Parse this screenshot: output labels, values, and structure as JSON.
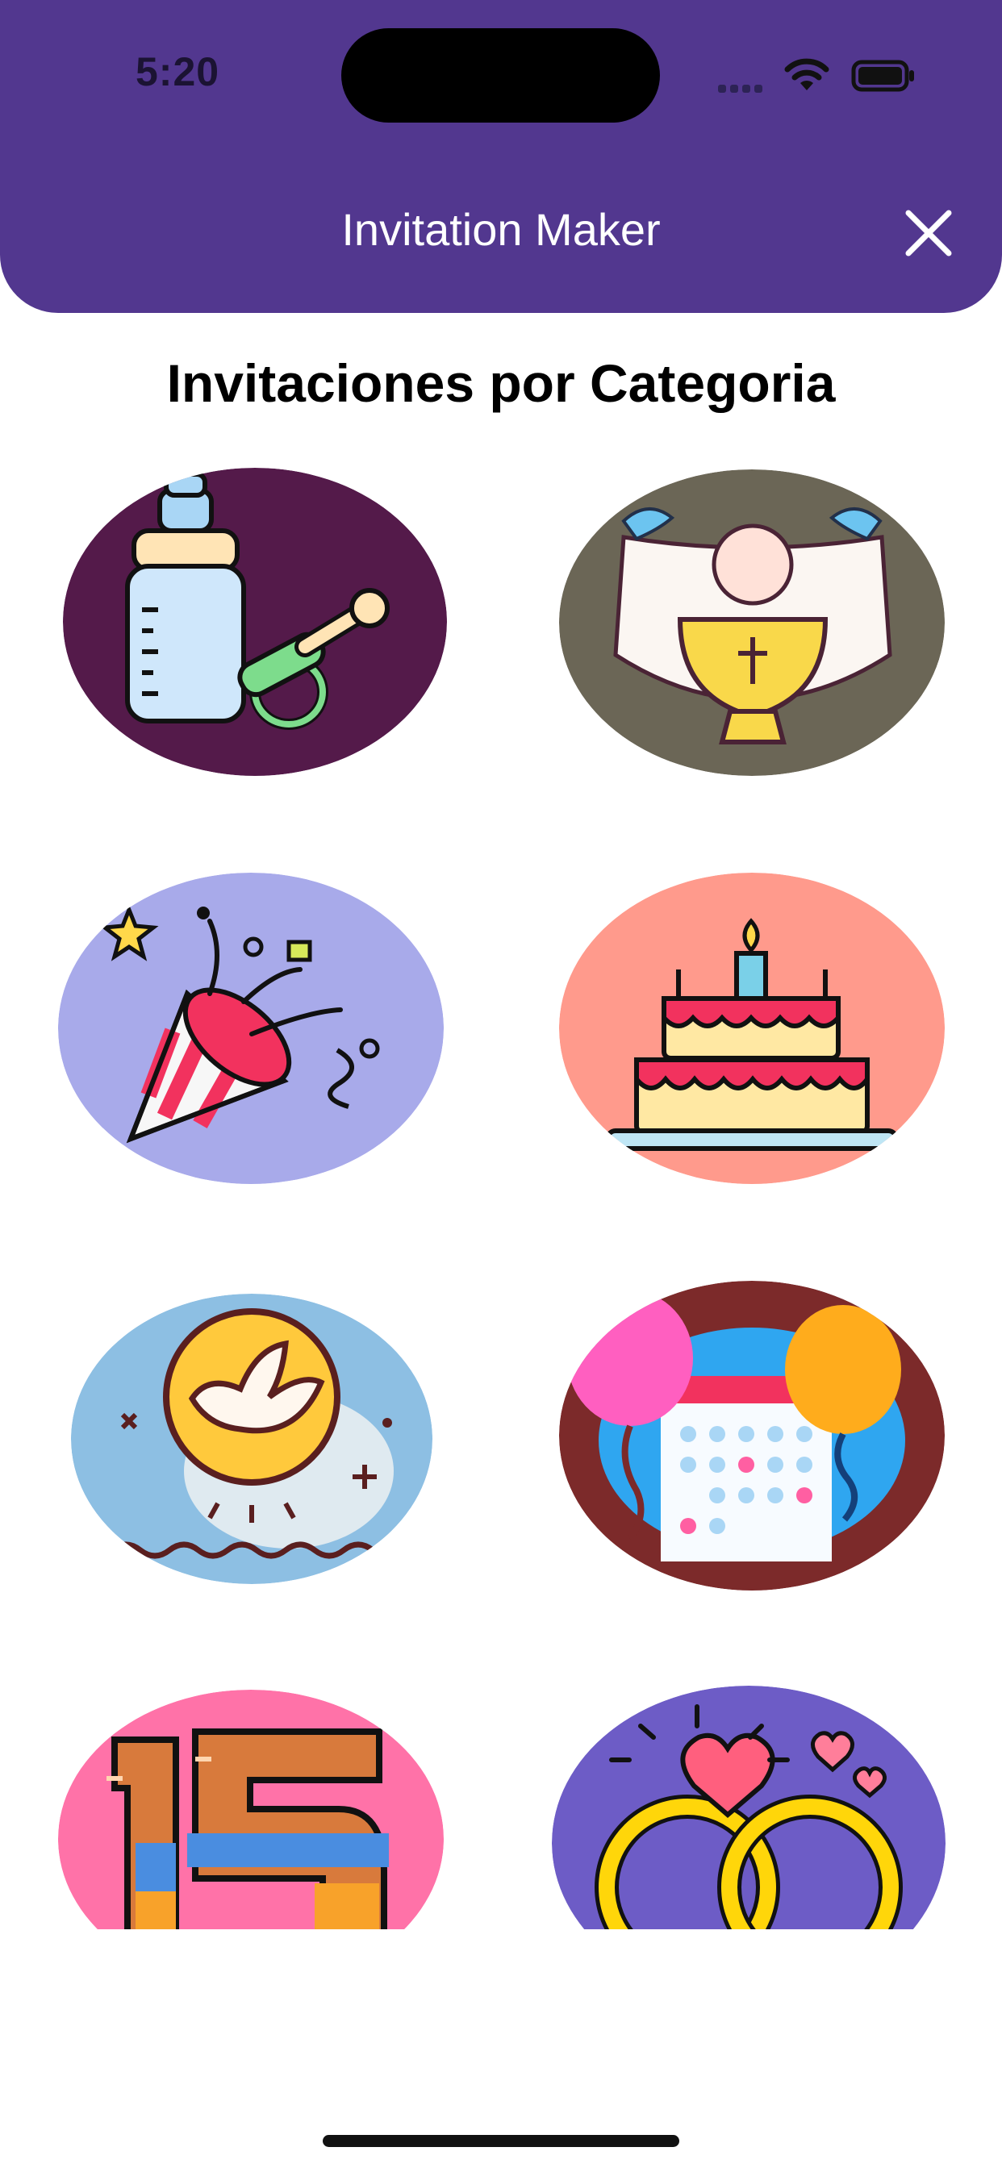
{
  "status_bar": {
    "time": "5:20"
  },
  "header": {
    "title": "Invitation Maker",
    "close_icon": "close-icon"
  },
  "main": {
    "section_title": "Invitaciones por Categoria"
  },
  "categories": [
    {
      "icon": "baby-bottle-icon",
      "bg": "#541a4a"
    },
    {
      "icon": "communion-chalice-icon",
      "bg": "#6b6656"
    },
    {
      "icon": "party-popper-icon",
      "bg": "#a8aaea"
    },
    {
      "icon": "birthday-cake-icon",
      "bg": "#ff9a8c"
    },
    {
      "icon": "dove-icon",
      "bg": "#8dbfe3"
    },
    {
      "icon": "calendar-balloons-icon",
      "bg": "#7c2a2a"
    },
    {
      "icon": "number-15-icon",
      "bg": "#ff72a8"
    },
    {
      "icon": "wedding-rings-icon",
      "bg": "#6d5cc6"
    }
  ],
  "colors": {
    "header_bg": "#52378f",
    "header_text": "#ffffff"
  }
}
